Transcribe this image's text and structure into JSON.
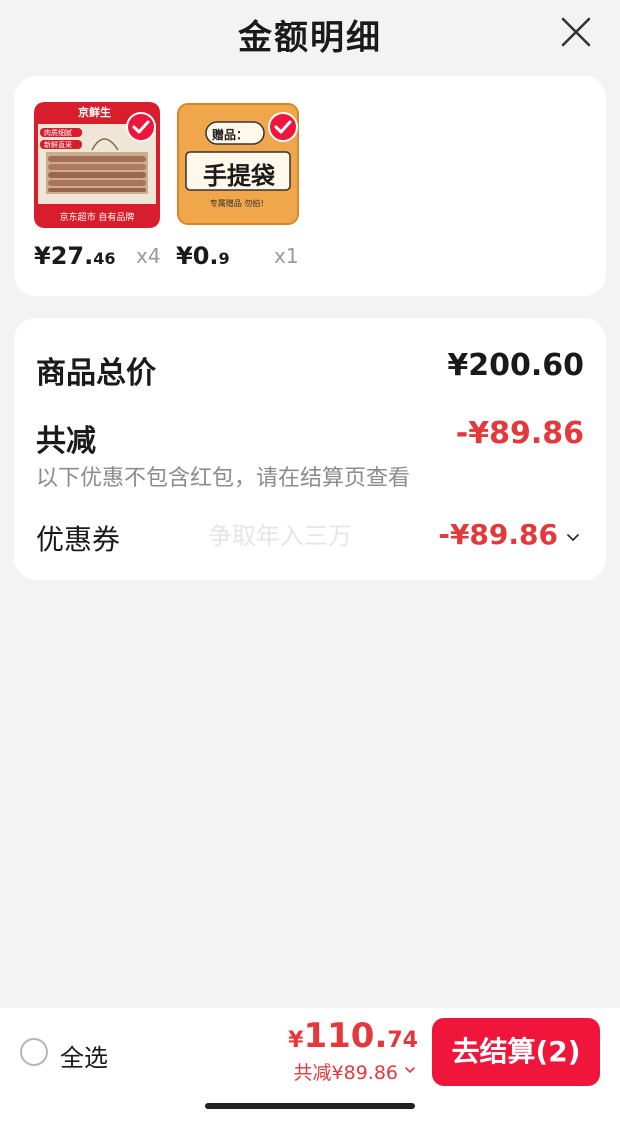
{
  "header": {
    "title": "金额明细",
    "close_icon": "close-icon"
  },
  "products": [
    {
      "brand_label": "京鲜生",
      "tag_1": "肉质细腻",
      "tag_2": "新鲜直采",
      "footer_text": "京东超市 自有品牌",
      "price_int": "¥27.",
      "price_dec": "46",
      "quantity": "x4",
      "selected": true
    },
    {
      "gift_label": "赠品：",
      "main_text": "手提袋",
      "sub_text": "专属赠品  勿拍！",
      "price_int": "¥0.",
      "price_dec": "9",
      "quantity": "x1",
      "selected": true
    }
  ],
  "summary": {
    "total_label": "商品总价",
    "total_value": "¥200.60",
    "reduce_label": "共减",
    "reduce_value": "-¥89.86",
    "note": "以下优惠不包含红包，请在结算页查看",
    "coupon_label": "优惠券",
    "coupon_value": "-¥89.86",
    "watermark": "争取年入三万"
  },
  "bottom_bar": {
    "select_all_label": "全选",
    "pay_currency": "¥",
    "pay_int": "110.",
    "pay_dec": "74",
    "pay_reduce": "共减¥89.86",
    "checkout_label": "去结算(2)"
  },
  "colors": {
    "accent_red": "#e4393c",
    "checkout_red": "#f0163b",
    "background": "#f3f3f3"
  }
}
